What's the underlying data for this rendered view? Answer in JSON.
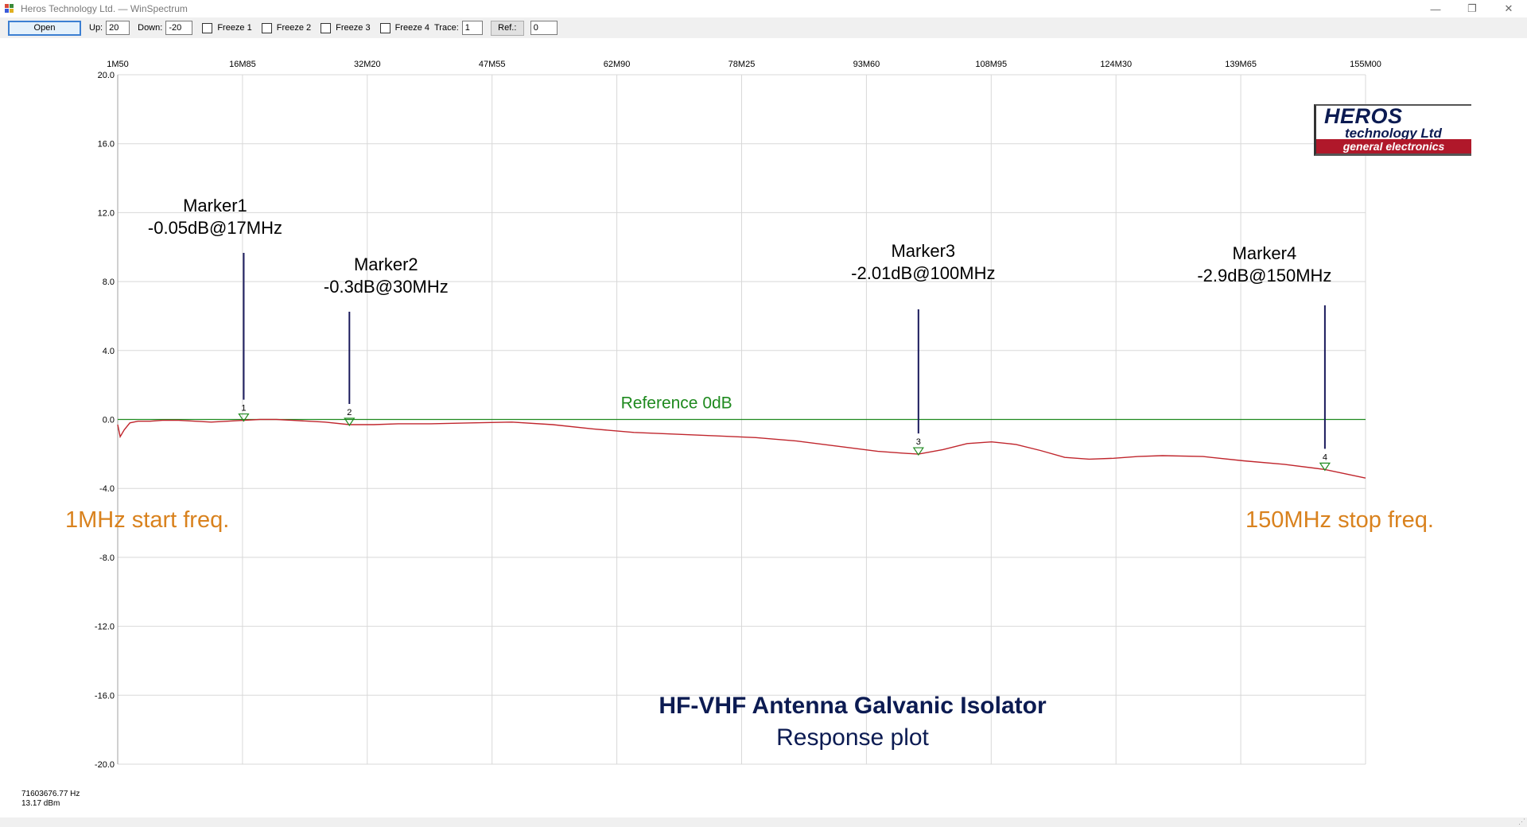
{
  "window": {
    "title": "Heros Technology Ltd.  —  WinSpectrum",
    "controls": {
      "minimize": "—",
      "restore": "❐",
      "close": "✕"
    }
  },
  "toolbar": {
    "open_label": "Open",
    "up_label": "Up:",
    "up_value": "20",
    "down_label": "Down:",
    "down_value": "-20",
    "freeze1": "Freeze 1",
    "freeze2": "Freeze 2",
    "freeze3": "Freeze 3",
    "freeze4": "Freeze 4",
    "trace_label": "Trace:",
    "trace_value": "1",
    "ref_button": "Ref.:",
    "ref_value": "0"
  },
  "logo": {
    "line1": "HEROS",
    "line2": "technology Ltd",
    "line3": "general electronics",
    "colors": {
      "navy": "#0c1b52",
      "red": "#b0182a"
    }
  },
  "status": {
    "frequency": "71603676.77 Hz",
    "level": "13.17 dBm"
  },
  "chart_data": {
    "type": "line",
    "title": "HF-VHF Antenna Galvanic Isolator",
    "subtitle": "Response plot",
    "xlabel": "",
    "ylabel": "",
    "xlim": [
      1.5,
      155.0
    ],
    "ylim": [
      -20,
      20
    ],
    "grid": true,
    "x_tick_labels": [
      "1M50",
      "16M85",
      "32M20",
      "47M55",
      "62M90",
      "78M25",
      "93M60",
      "108M95",
      "124M30",
      "139M65",
      "155M00"
    ],
    "y_tick_labels": [
      "20.0",
      "16.0",
      "12.0",
      "8.0",
      "4.0",
      "0.0",
      "-4.0",
      "-8.0",
      "-12.0",
      "-16.0",
      "-20.0"
    ],
    "y_ticks": [
      20,
      16,
      12,
      8,
      4,
      0,
      -4,
      -8,
      -12,
      -16,
      -20
    ],
    "reference": {
      "label": "Reference 0dB",
      "value": 0,
      "color": "#1f8a1f"
    },
    "series": [
      {
        "color": "#c0262d",
        "x": [
          1.5,
          1.8,
          2.3,
          3.0,
          4.0,
          5.5,
          7.0,
          9.0,
          11.0,
          13.0,
          15.0,
          17.0,
          19.0,
          21.0,
          23.0,
          25.0,
          27.0,
          30.0,
          33.0,
          36.0,
          40.0,
          45.0,
          50.0,
          55.0,
          60.0,
          65.0,
          70.0,
          75.0,
          80.0,
          85.0,
          90.0,
          95.0,
          98.0,
          100.0,
          103.0,
          106.0,
          109.0,
          112.0,
          115.0,
          118.0,
          121.0,
          124.0,
          127.0,
          130.0,
          135.0,
          140.0,
          145.0,
          150.0,
          155.0
        ],
        "values": [
          -0.3,
          -1.0,
          -0.6,
          -0.2,
          -0.1,
          -0.1,
          -0.05,
          -0.05,
          -0.1,
          -0.15,
          -0.1,
          -0.05,
          0.0,
          0.0,
          -0.05,
          -0.1,
          -0.15,
          -0.3,
          -0.3,
          -0.25,
          -0.25,
          -0.2,
          -0.15,
          -0.3,
          -0.55,
          -0.75,
          -0.85,
          -0.95,
          -1.05,
          -1.25,
          -1.55,
          -1.85,
          -1.95,
          -2.01,
          -1.75,
          -1.4,
          -1.3,
          -1.45,
          -1.8,
          -2.2,
          -2.3,
          -2.25,
          -2.15,
          -2.1,
          -2.15,
          -2.4,
          -2.6,
          -2.9,
          -3.4
        ]
      }
    ],
    "markers": [
      {
        "id": "1",
        "name": "Marker1",
        "label": "-0.05dB@17MHz",
        "x": 17,
        "y": -0.05
      },
      {
        "id": "2",
        "name": "Marker2",
        "label": "-0.3dB@30MHz",
        "x": 30,
        "y": -0.3
      },
      {
        "id": "3",
        "name": "Marker3",
        "label": "-2.01dB@100MHz",
        "x": 100,
        "y": -2.01
      },
      {
        "id": "4",
        "name": "Marker4",
        "label": "-2.9dB@150MHz",
        "x": 150,
        "y": -2.9
      }
    ],
    "annotations": {
      "start": "1MHz start freq.",
      "stop": "150MHz stop freq.",
      "color": "#d9821e",
      "title_color": "#0c1b52"
    }
  }
}
